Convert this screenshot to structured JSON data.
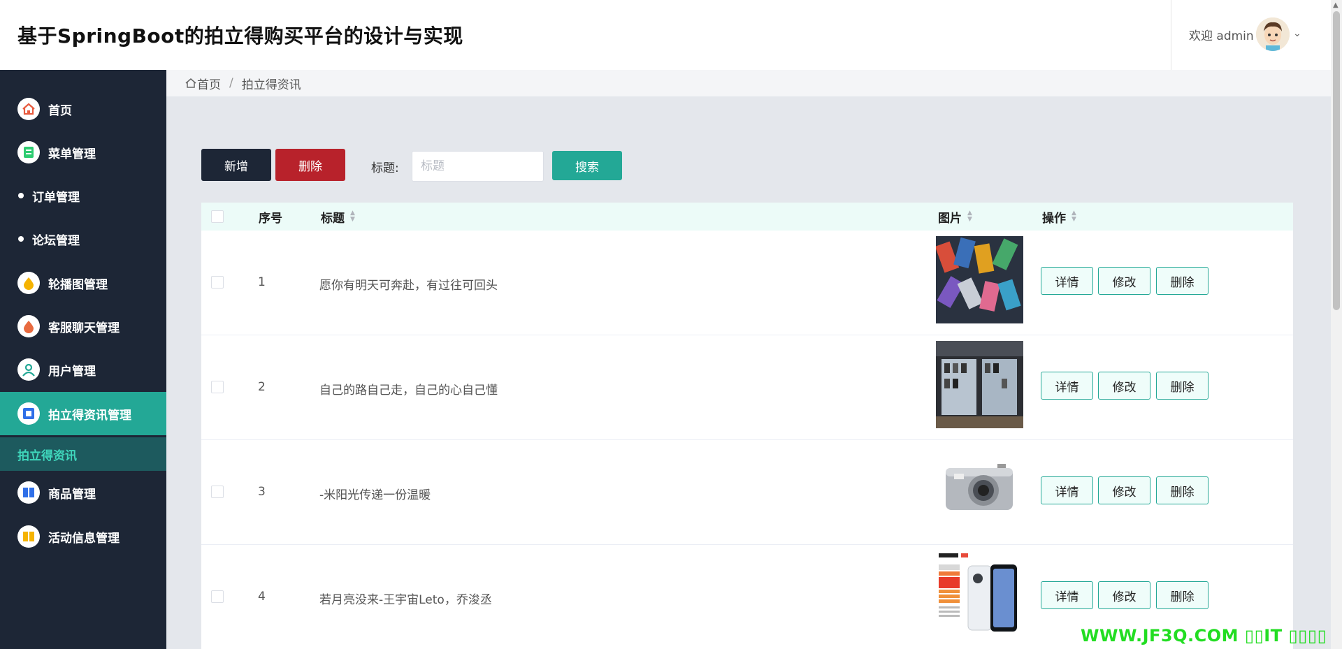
{
  "header": {
    "title": "基于SpringBoot的拍立得购买平台的设计与实现",
    "welcome": "欢迎 admin"
  },
  "sidebar": {
    "items": [
      {
        "label": "首页",
        "icon": "home-icon",
        "color": "#e85b3f"
      },
      {
        "label": "菜单管理",
        "icon": "menu-icon",
        "color": "#2ecc71"
      },
      {
        "label": "订单管理",
        "icon": "bullet"
      },
      {
        "label": "论坛管理",
        "icon": "bullet"
      },
      {
        "label": "轮播图管理",
        "icon": "drop-icon",
        "color": "#f5b301"
      },
      {
        "label": "客服聊天管理",
        "icon": "drop-icon",
        "color": "#e86a3f"
      },
      {
        "label": "用户管理",
        "icon": "user-icon",
        "color": "#23a896"
      },
      {
        "label": "拍立得资讯管理",
        "icon": "news-icon",
        "color": "#2f6fe8"
      },
      {
        "label": "商品管理",
        "icon": "book-icon",
        "color": "#2f6fe8"
      },
      {
        "label": "活动信息管理",
        "icon": "book-icon",
        "color": "#f5b301"
      }
    ],
    "active_index": 7,
    "submenu_label": "拍立得资讯"
  },
  "breadcrumb": {
    "home": "首页",
    "separator": "/",
    "current": "拍立得资讯"
  },
  "toolbar": {
    "add_label": "新增",
    "delete_label": "删除",
    "search_label": "标题:",
    "search_placeholder": "标题",
    "search_button": "搜索"
  },
  "table": {
    "columns": {
      "index": "序号",
      "title": "标题",
      "image": "图片",
      "actions": "操作"
    },
    "rows": [
      {
        "index": "1",
        "title": "愿你有明天可奔赴，有过往可回头",
        "image": "phones-collage-image"
      },
      {
        "index": "2",
        "title": "自己的路自己走，自己的心自己懂",
        "image": "store-display-image"
      },
      {
        "index": "3",
        "title": "-米阳光传递一份温暖",
        "image": "silver-camera-image"
      },
      {
        "index": "4",
        "title": "若月亮没来-王宇宙Leto，乔浚丞",
        "image": "iqoo-phone-ad-image"
      }
    ],
    "action_labels": {
      "detail": "详情",
      "edit": "修改",
      "delete": "删除"
    }
  },
  "watermark": "WWW.JF3Q.COM ▯▯IT ▯▯▯▯",
  "colors": {
    "sidebar": "#1d2636",
    "accent": "#23a896",
    "danger": "#b8222b"
  }
}
